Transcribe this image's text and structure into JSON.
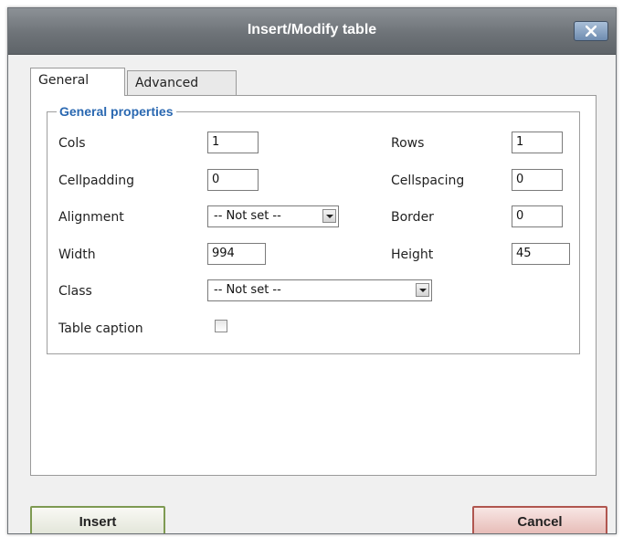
{
  "dialog": {
    "title": "Insert/Modify table"
  },
  "tabs": [
    {
      "label": "General",
      "active": true
    },
    {
      "label": "Advanced",
      "active": false
    }
  ],
  "general": {
    "legend": "General properties",
    "cols_label": "Cols",
    "cols_value": "1",
    "rows_label": "Rows",
    "rows_value": "1",
    "cellpadding_label": "Cellpadding",
    "cellpadding_value": "0",
    "cellspacing_label": "Cellspacing",
    "cellspacing_value": "0",
    "alignment_label": "Alignment",
    "alignment_value": "-- Not set --",
    "border_label": "Border",
    "border_value": "0",
    "width_label": "Width",
    "width_value": "994",
    "height_label": "Height",
    "height_value": "45",
    "class_label": "Class",
    "class_value": "-- Not set --",
    "caption_label": "Table caption",
    "caption_checked": false
  },
  "buttons": {
    "insert": "Insert",
    "cancel": "Cancel"
  },
  "icons": {
    "close": "close-icon",
    "dropdown": "chevron-down-icon"
  },
  "colors": {
    "legend": "#2a68b1",
    "titlebar": "#6e7378",
    "insert_border": "#7e9a52",
    "cancel_border": "#b0564f"
  }
}
